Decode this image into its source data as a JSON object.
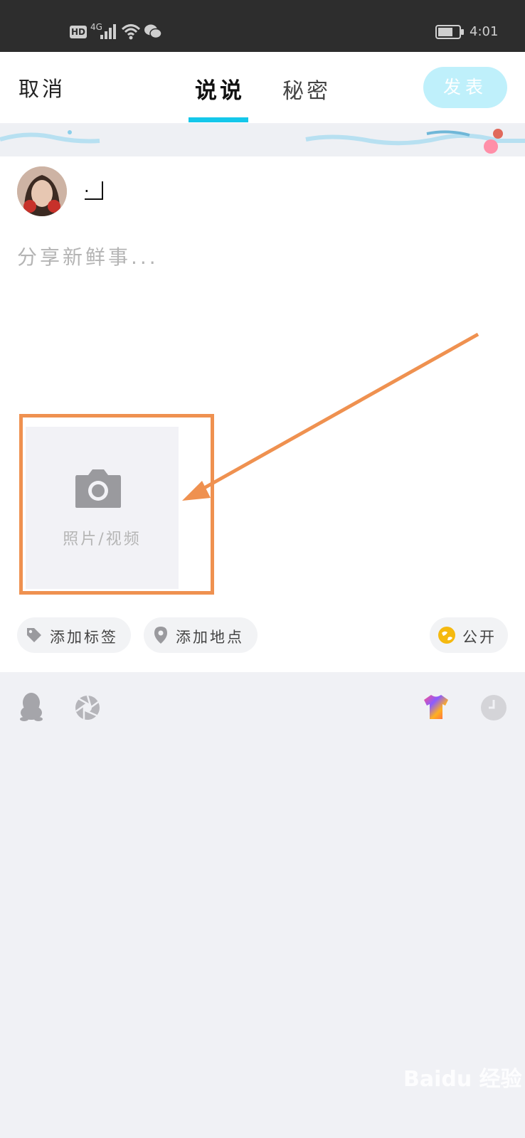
{
  "status_bar": {
    "network_hd": "HD",
    "network_type": "4G",
    "time": "4:01"
  },
  "header": {
    "cancel_label": "取消",
    "tabs": [
      {
        "label": "说说",
        "active": true
      },
      {
        "label": "秘密",
        "active": false
      }
    ],
    "publish_label": "发表",
    "accent_color": "#14c7ea"
  },
  "composer": {
    "username": "·",
    "placeholder": "分享新鲜事...",
    "media_label": "照片/视频"
  },
  "options": {
    "add_tag_label": "添加标签",
    "add_location_label": "添加地点",
    "visibility_label": "公开"
  },
  "annotation": {
    "highlight_color": "#ef9150"
  },
  "watermark": {
    "text": "Baidu 经验"
  }
}
